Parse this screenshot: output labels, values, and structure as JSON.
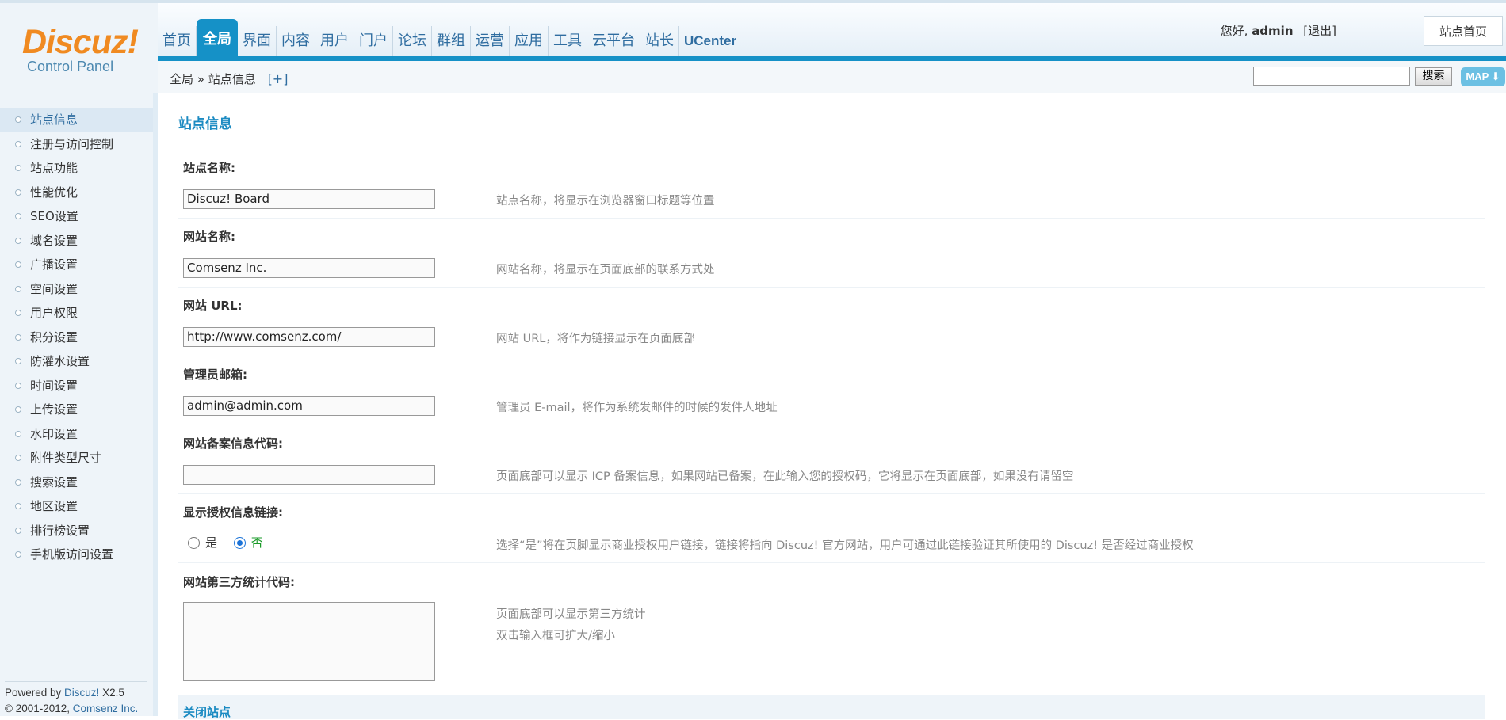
{
  "logo": {
    "brand": "Discuz!",
    "sub": "Control Panel"
  },
  "nav": {
    "items": [
      "首页",
      "全局",
      "界面",
      "内容",
      "用户",
      "门户",
      "论坛",
      "群组",
      "运营",
      "应用",
      "工具",
      "云平台",
      "站长",
      "UCenter"
    ],
    "active": "全局"
  },
  "user": {
    "greeting": "您好,",
    "name": "admin",
    "logout": "[退出]",
    "home": "站点首页"
  },
  "breadcrumb": {
    "root": "全局",
    "sep": "»",
    "current": "站点信息",
    "add": "[+]"
  },
  "search": {
    "value": "",
    "button": "搜索",
    "map": "MAP ⬇"
  },
  "sidebar": {
    "items": [
      "站点信息",
      "注册与访问控制",
      "站点功能",
      "性能优化",
      "SEO设置",
      "域名设置",
      "广播设置",
      "空间设置",
      "用户权限",
      "积分设置",
      "防灌水设置",
      "时间设置",
      "上传设置",
      "水印设置",
      "附件类型尺寸",
      "搜索设置",
      "地区设置",
      "排行榜设置",
      "手机版访问设置"
    ],
    "active": "站点信息"
  },
  "footer": {
    "powered_prefix": "Powered by ",
    "powered_brand": "Discuz!",
    "version": " X2.5",
    "copyright_prefix": "© 2001-2012, ",
    "company": "Comsenz Inc."
  },
  "page": {
    "title": "站点信息"
  },
  "form": {
    "sitename": {
      "label": "站点名称:",
      "value": "Discuz! Board",
      "tip": "站点名称，将显示在浏览器窗口标题等位置"
    },
    "bbname": {
      "label": "网站名称:",
      "value": "Comsenz Inc.",
      "tip": "网站名称，将显示在页面底部的联系方式处"
    },
    "siteurl": {
      "label": "网站 URL:",
      "value": "http://www.comsenz.com/",
      "tip": "网站 URL，将作为链接显示在页面底部"
    },
    "adminemail": {
      "label": "管理员邮箱:",
      "value": "admin@admin.com",
      "tip": "管理员 E-mail，将作为系统发邮件的时候的发件人地址"
    },
    "icp": {
      "label": "网站备案信息代码:",
      "value": "",
      "tip": "页面底部可以显示 ICP 备案信息，如果网站已备案，在此输入您的授权码，它将显示在页面底部，如果没有请留空"
    },
    "license": {
      "label": "显示授权信息链接:",
      "yes": "是",
      "no": "否",
      "selected": "否",
      "tip": "选择“是”将在页脚显示商业授权用户链接，链接将指向 Discuz! 官方网站，用户可通过此链接验证其所使用的 Discuz! 是否经过商业授权"
    },
    "stats": {
      "label": "网站第三方统计代码:",
      "value": "",
      "tip1": "页面底部可以显示第三方统计",
      "tip2": "双击输入框可扩大/缩小"
    }
  },
  "close_section": {
    "title": "关闭站点"
  }
}
